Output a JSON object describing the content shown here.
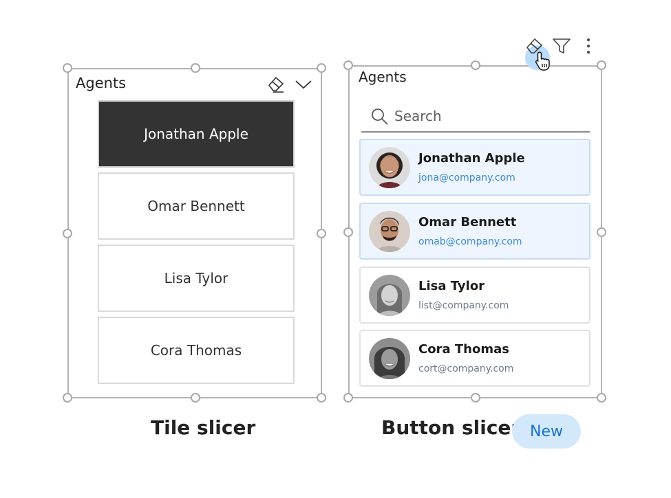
{
  "tile_slicer": {
    "title": "Agents",
    "icons": [
      "eraser-icon",
      "chevron-down-icon"
    ],
    "items": [
      {
        "label": "Jonathan Apple",
        "selected": true
      },
      {
        "label": "Omar Bennett",
        "selected": false
      },
      {
        "label": "Lisa Tylor",
        "selected": false
      },
      {
        "label": "Cora Thomas",
        "selected": false
      }
    ],
    "caption": "Tile slicer"
  },
  "button_slicer": {
    "title": "Agents",
    "toolbar_icons": [
      "eraser-icon",
      "filter-icon",
      "more-vertical-icon"
    ],
    "search": {
      "placeholder": "Search",
      "value": ""
    },
    "items": [
      {
        "name": "Jonathan Apple",
        "email": "jona@company.com",
        "selected": true
      },
      {
        "name": "Omar Bennett",
        "email": "omab@company.com",
        "selected": true
      },
      {
        "name": "Lisa Tylor",
        "email": "list@company.com",
        "selected": false
      },
      {
        "name": "Cora Thomas",
        "email": "cort@company.com",
        "selected": false
      }
    ],
    "caption": "Button slicer",
    "badge": "New"
  },
  "colors": {
    "selected_tile": "#333333",
    "selected_card_bg": "#eef5fe",
    "selected_email": "#3b8bd9",
    "badge_bg": "#d4e8fc",
    "badge_text": "#1a73d1"
  }
}
